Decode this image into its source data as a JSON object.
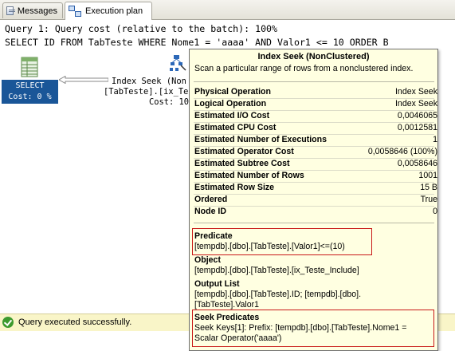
{
  "tabs": [
    {
      "label": "Messages",
      "icon": "messages-icon",
      "active": false
    },
    {
      "label": "Execution plan",
      "icon": "execution-plan-icon",
      "active": true
    }
  ],
  "query": {
    "header": "Query 1: Query cost (relative to the batch): 100%",
    "sql": "SELECT ID FROM TabTeste WHERE Nome1 = 'aaaa' AND Valor1 <= 10 ORDER B"
  },
  "plan": {
    "select_node": {
      "line1": "SELECT",
      "line2": "Cost: 0 %"
    },
    "seek_node": {
      "line1": "Index Seek (Non",
      "line2": "[TabTeste].[ix_Te",
      "line3": "Cost: 10"
    }
  },
  "tooltip": {
    "title": "Index Seek (NonClustered)",
    "description": "Scan a particular range of rows from a nonclustered index.",
    "properties": [
      {
        "key": "Physical Operation",
        "value": "Index Seek"
      },
      {
        "key": "Logical Operation",
        "value": "Index Seek"
      },
      {
        "key": "Estimated I/O Cost",
        "value": "0,0046065"
      },
      {
        "key": "Estimated CPU Cost",
        "value": "0,0012581"
      },
      {
        "key": "Estimated Number of Executions",
        "value": "1"
      },
      {
        "key": "Estimated Operator Cost",
        "value": "0,0058646 (100%)"
      },
      {
        "key": "Estimated Subtree Cost",
        "value": "0,0058646"
      },
      {
        "key": "Estimated Number of Rows",
        "value": "1001"
      },
      {
        "key": "Estimated Row Size",
        "value": "15 B"
      },
      {
        "key": "Ordered",
        "value": "True"
      },
      {
        "key": "Node ID",
        "value": "0"
      }
    ],
    "predicate": {
      "heading": "Predicate",
      "text": "[tempdb].[dbo].[TabTeste].[Valor1]<=(10)"
    },
    "object": {
      "heading": "Object",
      "text": "[tempdb].[dbo].[TabTeste].[ix_Teste_Include]"
    },
    "output_list": {
      "heading": "Output List",
      "line1": "[tempdb].[dbo].[TabTeste].ID; [tempdb].[dbo].",
      "line2": "[TabTeste].Valor1"
    },
    "seek_predicates": {
      "heading": "Seek Predicates",
      "line1": "Seek Keys[1]: Prefix: [tempdb].[dbo].[TabTeste].Nome1 =",
      "line2": "Scalar Operator('aaaa')"
    }
  },
  "status": {
    "text": "Query executed successfully.",
    "icon": "success-check-icon",
    "color": "#3c9a2e"
  },
  "colors": {
    "select_bg": "#1a5698",
    "tooltip_bg": "#ffffe1",
    "status_bg": "#f9f5c8",
    "highlight_border": "#c81818"
  }
}
